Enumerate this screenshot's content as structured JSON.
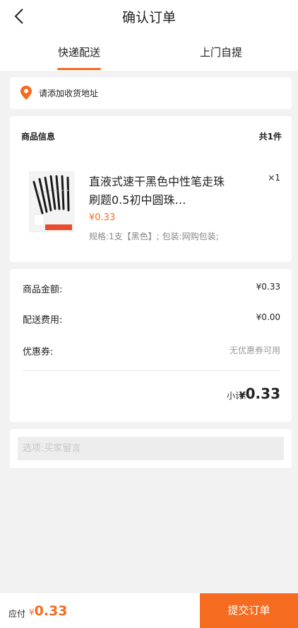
{
  "header": {
    "title": "确认订单",
    "back_icon": "chevron-left-icon"
  },
  "tabs": [
    {
      "label": "快递配送",
      "active": true
    },
    {
      "label": "上门自提",
      "active": false
    }
  ],
  "address": {
    "text": "请添加收货地址",
    "icon": "location-pin-icon"
  },
  "goods": {
    "header": "商品信息",
    "count": "共1件",
    "item": {
      "name": "直液式速干黑色中性笔走珠刷题0.5初中圆珠…",
      "price": "¥0.33",
      "spec": "规格:1支【黑色】; 包装:网购包装;",
      "qty": "×1"
    }
  },
  "amounts": {
    "goods_amount_label": "商品金额:",
    "goods_amount_value": "¥0.33",
    "shipping_label": "配送费用:",
    "shipping_value": "¥0.00",
    "coupon_label": "优惠券:",
    "coupon_value": "无优惠券可用",
    "subtotal_label": "小计:",
    "subtotal_currency": "¥",
    "subtotal_value": "0.33"
  },
  "remark": {
    "placeholder": "选项:买家留言"
  },
  "footer": {
    "pay_label": "应付",
    "pay_currency": "¥",
    "pay_amount": "0.33",
    "submit_label": "提交订单"
  },
  "colors": {
    "accent": "#f56b1f",
    "background": "#f2f2f2"
  }
}
